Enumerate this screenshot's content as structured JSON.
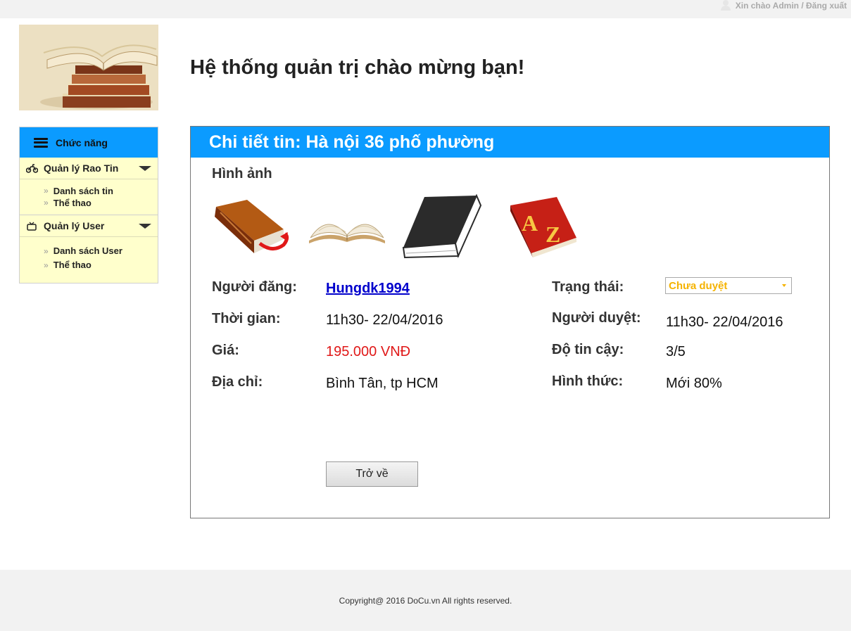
{
  "topbar": {
    "greeting": "Xin chào Admin / Đăng xuất",
    "user_icon": "user-icon"
  },
  "logo": {
    "icon": "books-stack-logo"
  },
  "header": {
    "title": "Hệ thống quản trị chào mừng bạn!"
  },
  "sidebar": {
    "title": "Chức năng",
    "title_icon": "menu-icon",
    "groups": [
      {
        "label": "Quản lý Rao Tin",
        "icon": "motorbike-icon",
        "items": [
          "Danh sách tin",
          "Thể thao"
        ]
      },
      {
        "label": "Quản lý User",
        "icon": "tv-icon",
        "items": [
          "Danh sách User",
          "Thể thao"
        ]
      }
    ]
  },
  "detail": {
    "title": "Chi tiết tin: Hà nội 36 phố phường",
    "images_label": "Hình ảnh",
    "images": [
      "red-book-icon",
      "open-book-icon",
      "black-book-icon",
      "dictionary-az-icon"
    ],
    "fields": {
      "poster_label": "Người đăng:",
      "poster_value": "Hungdk1994",
      "time_label": "Thời gian:",
      "time_value": "11h30-  22/04/2016",
      "price_label": "Giá:",
      "price_value": "195.000 VNĐ",
      "address_label": "Địa chỉ:",
      "address_value": "Bình Tân, tp HCM",
      "status_label": "Trạng thái:",
      "status_value": "Chưa duyệt",
      "approver_label": "Người duyệt:",
      "approver_value": "11h30-  22/04/2016",
      "trust_label": "Độ tin cậy:",
      "trust_value": "3/5",
      "form_label": "Hình thức:",
      "form_value": "Mới 80%"
    },
    "back_button": "Trở về"
  },
  "footer": {
    "copyright": "Copyright@ 2016 DoCu.vn All rights reserved."
  },
  "colors": {
    "accent": "#0b9bff",
    "sidebar_bg": "#ffffcc",
    "price": "#e01818",
    "status": "#f5b301",
    "link": "#0000cc"
  }
}
